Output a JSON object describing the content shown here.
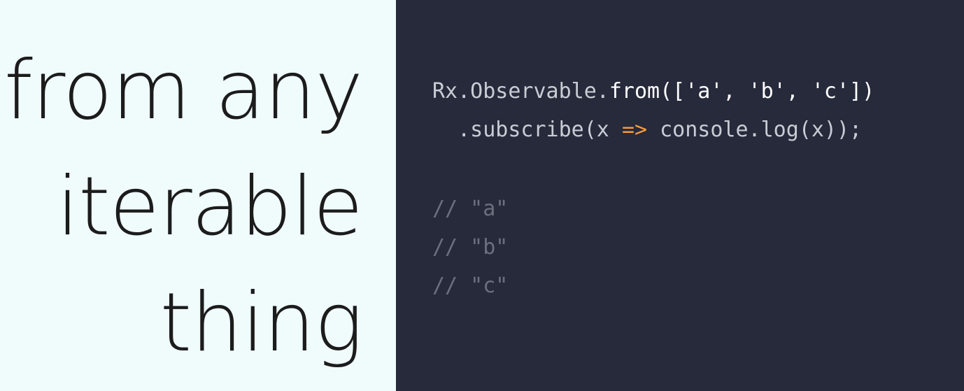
{
  "slide": {
    "title_lines": [
      "from any",
      "iterable",
      "thing"
    ],
    "code": {
      "line1": {
        "prefix": "Rx.Observable.",
        "method": "from",
        "args": "(['a', 'b', 'c'])"
      },
      "line2": {
        "indent": "  ",
        "prefix": ".subscribe(x ",
        "arrow": "=>",
        "suffix": " console.log(x));"
      }
    },
    "output_comments": [
      "// \"a\"",
      "// \"b\"",
      "// \"c\""
    ],
    "colors": {
      "left_background": "#f0fbfc",
      "right_background": "#262a3b",
      "code_text": "#c8ccd4",
      "highlight": "#ffffff",
      "arrow": "#f39c3c",
      "comment": "#6b6f7e"
    }
  }
}
